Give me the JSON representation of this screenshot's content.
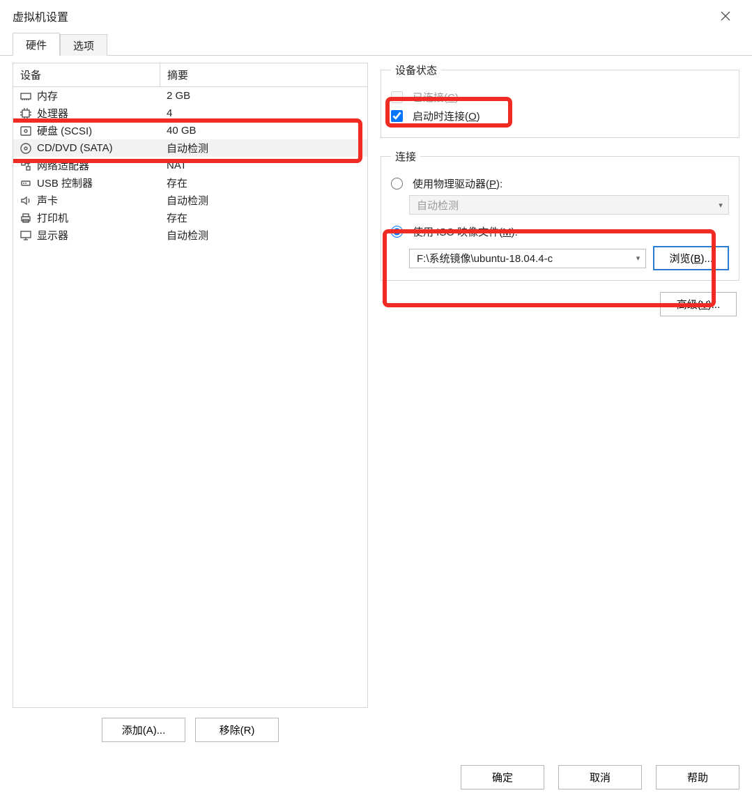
{
  "window": {
    "title": "虚拟机设置"
  },
  "tabs": {
    "hardware": "硬件",
    "options": "选项"
  },
  "deviceList": {
    "header": {
      "device": "设备",
      "summary": "摘要"
    },
    "rows": [
      {
        "name": "内存",
        "summary": "2 GB",
        "icon": "memory"
      },
      {
        "name": "处理器",
        "summary": "4",
        "icon": "cpu"
      },
      {
        "name": "硬盘 (SCSI)",
        "summary": "40 GB",
        "icon": "disk"
      },
      {
        "name": "CD/DVD (SATA)",
        "summary": "自动检测",
        "icon": "cd",
        "selected": true
      },
      {
        "name": "网络适配器",
        "summary": "NAT",
        "icon": "net"
      },
      {
        "name": "USB 控制器",
        "summary": "存在",
        "icon": "usb"
      },
      {
        "name": "声卡",
        "summary": "自动检测",
        "icon": "sound"
      },
      {
        "name": "打印机",
        "summary": "存在",
        "icon": "printer"
      },
      {
        "name": "显示器",
        "summary": "自动检测",
        "icon": "display"
      }
    ],
    "addBtn": "添加(A)...",
    "removeBtn": "移除(R)"
  },
  "status": {
    "legend": "设备状态",
    "connected": "已连接(C)",
    "connectAtPowerOn": "启动时连接(O)"
  },
  "connection": {
    "legend": "连接",
    "physical": "使用物理驱动器(P):",
    "physicalValue": "自动检测",
    "iso": "使用 ISO 映像文件(M):",
    "isoValue": "F:\\系统镜像\\ubuntu-18.04.4-c",
    "browse": "浏览(B)...",
    "advanced": "高级(V)..."
  },
  "buttons": {
    "ok": "确定",
    "cancel": "取消",
    "help": "帮助"
  }
}
